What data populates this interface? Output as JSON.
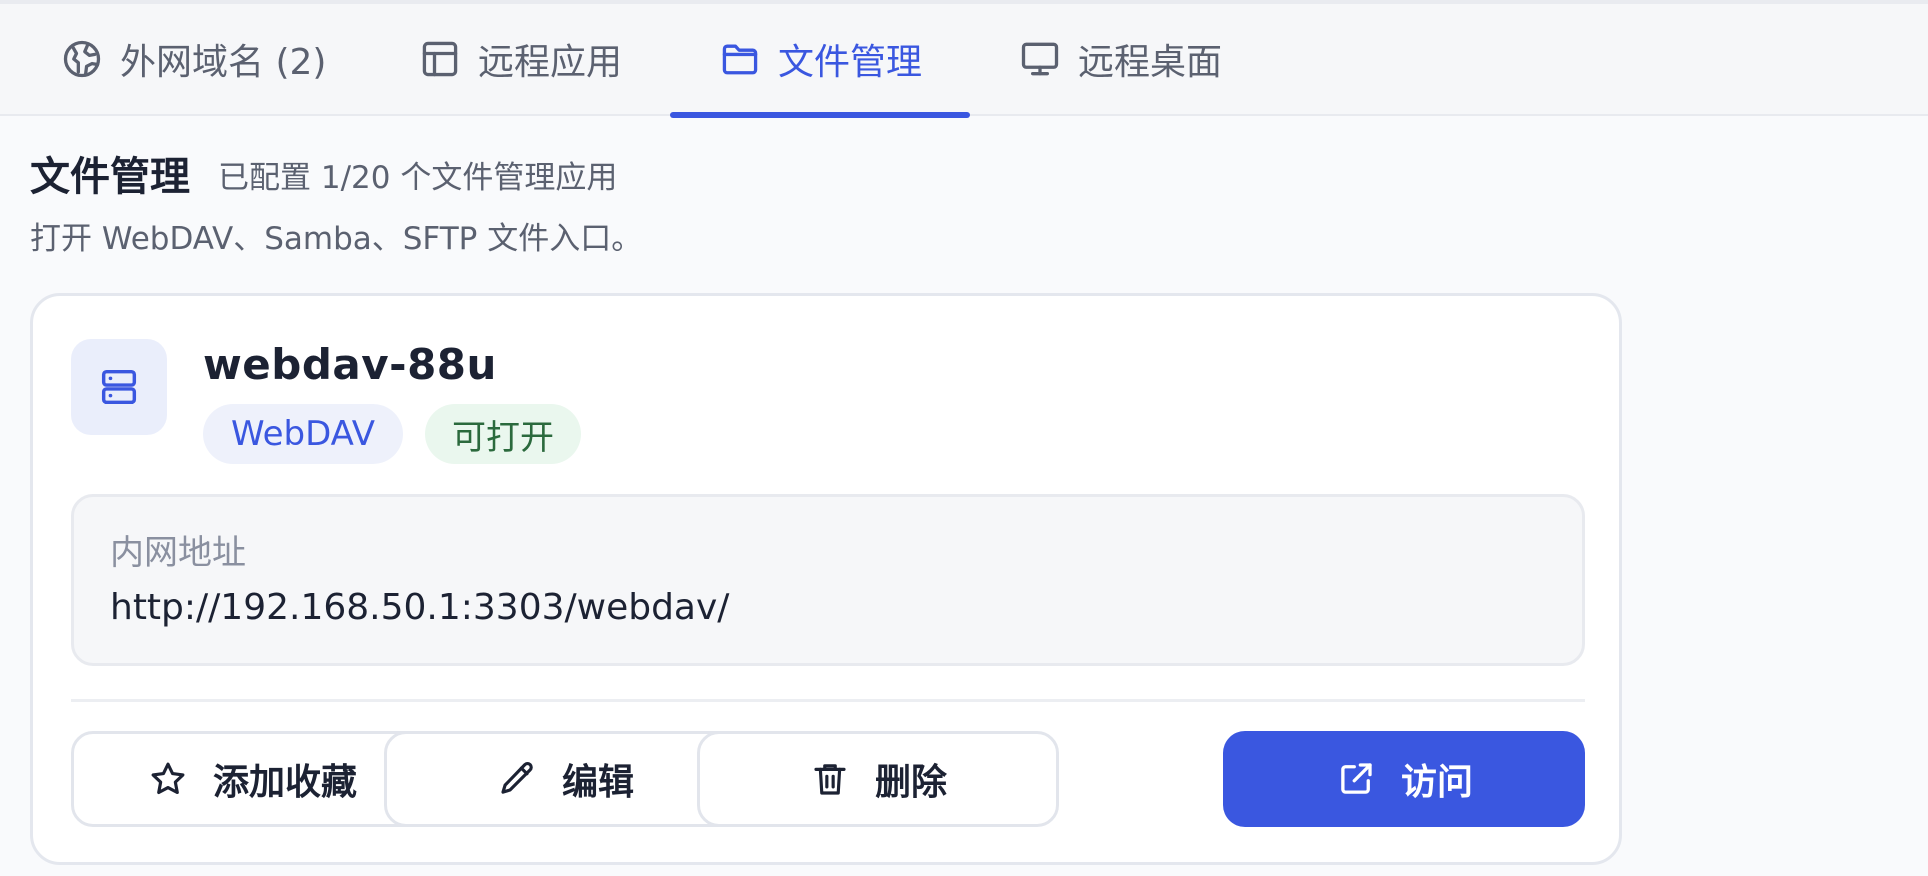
{
  "tabs": [
    {
      "label": "外网域名 (2)",
      "icon": "globe-icon"
    },
    {
      "label": "远程应用",
      "icon": "app-layout-icon"
    },
    {
      "label": "文件管理",
      "icon": "folder-icon",
      "active": true
    },
    {
      "label": "远程桌面",
      "icon": "monitor-icon"
    }
  ],
  "header": {
    "title": "文件管理",
    "subtitle": "已配置 1/20 个文件管理应用",
    "description": "打开 WebDAV、Samba、SFTP 文件入口。"
  },
  "card": {
    "icon": "server-icon",
    "name": "webdav-88u",
    "type_badge": "WebDAV",
    "status_badge": "可打开",
    "address_label": "内网地址",
    "address_value": "http://192.168.50.1:3303/webdav/",
    "actions": {
      "favorite": "添加收藏",
      "edit": "编辑",
      "delete": "删除",
      "visit": "访问"
    }
  },
  "colors": {
    "accent": "#3a57e0",
    "status_bg": "#eaf7ee",
    "status_text": "#2b6a3d"
  }
}
